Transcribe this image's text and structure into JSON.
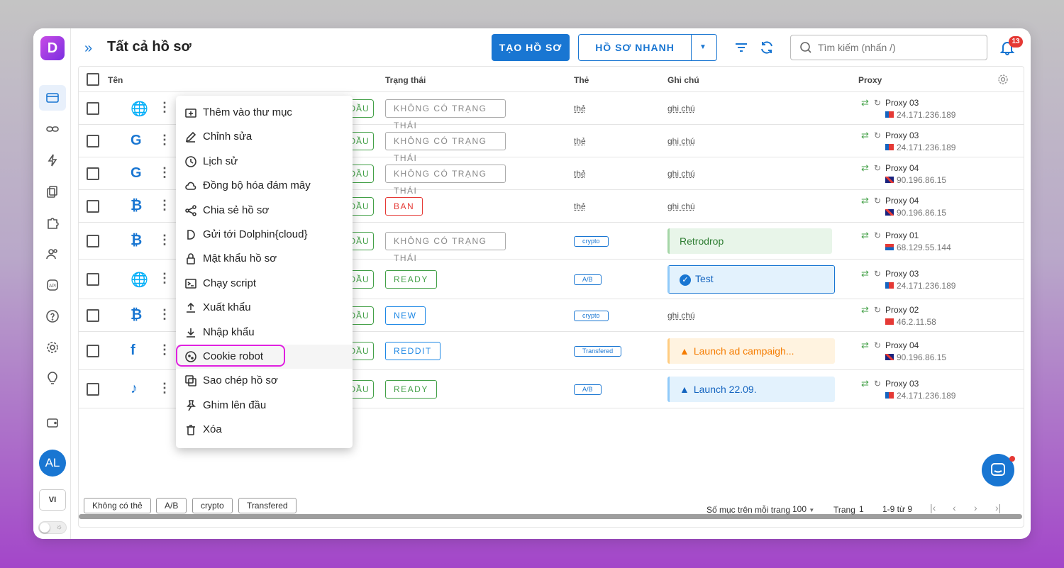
{
  "header": {
    "title": "Tất cả hồ sơ",
    "create_label": "TẠO HỒ SƠ",
    "quick_label": "HỒ SƠ NHANH",
    "search_placeholder": "Tìm kiếm (nhấn /)",
    "notification_count": "13"
  },
  "sidebar": {
    "logo": "D",
    "avatar": "AL",
    "lang": "VI"
  },
  "table": {
    "columns": [
      "Tên",
      "Trạng thái",
      "Thẻ",
      "Ghi chú",
      "Proxy"
    ],
    "start_label": "ĐẦU",
    "rows": [
      {
        "site_icon": "globe-icon",
        "status": "KHÔNG CÓ TRẠNG THÁI",
        "status_kind": "none",
        "tag": "thẻ",
        "tag_kind": "link",
        "note": "ghi chú",
        "note_kind": "link",
        "proxy": "Proxy 03",
        "ip": "24.171.236.189",
        "flag": "pr"
      },
      {
        "site_icon": "google-icon",
        "status": "KHÔNG CÓ TRẠNG THÁI",
        "status_kind": "none",
        "tag": "thẻ",
        "tag_kind": "link",
        "note": "ghi chú",
        "note_kind": "link",
        "proxy": "Proxy 03",
        "ip": "24.171.236.189",
        "flag": "pr"
      },
      {
        "site_icon": "google-icon",
        "status": "KHÔNG CÓ TRẠNG THÁI",
        "status_kind": "none",
        "tag": "thẻ",
        "tag_kind": "link",
        "note": "ghi chú",
        "note_kind": "link",
        "proxy": "Proxy 04",
        "ip": "90.196.86.15",
        "flag": "uk"
      },
      {
        "site_icon": "bitcoin-icon",
        "status": "BAN",
        "status_kind": "ban",
        "tag": "thẻ",
        "tag_kind": "link",
        "note": "ghi chú",
        "note_kind": "link",
        "proxy": "Proxy 04",
        "ip": "90.196.86.15",
        "flag": "uk"
      },
      {
        "site_icon": "bitcoin-icon",
        "status": "KHÔNG CÓ TRẠNG THÁI",
        "status_kind": "none",
        "tag": "crypto",
        "tag_kind": "chip",
        "note": "Retrodrop",
        "note_kind": "green",
        "proxy": "Proxy 01",
        "ip": "68.129.55.144",
        "flag": "us"
      },
      {
        "site_icon": "globe-icon",
        "status": "READY",
        "status_kind": "ready",
        "tag": "A/B",
        "tag_kind": "chip",
        "note": "Test",
        "note_kind": "blue",
        "proxy": "Proxy 03",
        "ip": "24.171.236.189",
        "flag": "pr"
      },
      {
        "site_icon": "bitcoin-icon",
        "status": "NEW",
        "status_kind": "new",
        "tag": "crypto",
        "tag_kind": "chip",
        "note": "ghi chú",
        "note_kind": "link",
        "proxy": "Proxy 02",
        "ip": "46.2.11.58",
        "flag": "tr"
      },
      {
        "site_icon": "facebook-icon",
        "status": "REDDIT",
        "status_kind": "reddit",
        "tag": "Transfered",
        "tag_kind": "chip",
        "note": "Launch ad campaigh...",
        "note_kind": "orange",
        "proxy": "Proxy 04",
        "ip": "90.196.86.15",
        "flag": "uk"
      },
      {
        "site_icon": "tiktok-icon",
        "status": "READY",
        "status_kind": "ready",
        "tag": "A/B",
        "tag_kind": "chip",
        "note": "Launch 22.09.",
        "note_kind": "lblue",
        "proxy": "Proxy 03",
        "ip": "24.171.236.189",
        "flag": "pr"
      }
    ]
  },
  "context_menu": {
    "items": [
      {
        "label": "Thêm vào thư mục",
        "icon": "folder-add-icon"
      },
      {
        "label": "Chỉnh sửa",
        "icon": "edit-icon"
      },
      {
        "label": "Lịch sử",
        "icon": "history-icon"
      },
      {
        "label": "Đồng bộ hóa đám mây",
        "icon": "cloud-icon"
      },
      {
        "label": "Chia sẻ hồ sơ",
        "icon": "share-icon"
      },
      {
        "label": "Gửi tới Dolphin{cloud}",
        "icon": "dolphin-icon"
      },
      {
        "label": "Mật khẩu hồ sơ",
        "icon": "lock-icon"
      },
      {
        "label": "Chạy script",
        "icon": "terminal-icon"
      },
      {
        "label": "Xuất khẩu",
        "icon": "upload-icon"
      },
      {
        "label": "Nhập khẩu",
        "icon": "download-icon"
      },
      {
        "label": "Cookie robot",
        "icon": "cookie-icon"
      },
      {
        "label": "Sao chép hồ sơ",
        "icon": "copy-icon"
      },
      {
        "label": "Ghim lên đầu",
        "icon": "pin-icon"
      },
      {
        "label": "Xóa",
        "icon": "trash-icon"
      }
    ],
    "highlighted": "Cookie robot"
  },
  "footer": {
    "tags": [
      "Không có thẻ",
      "A/B",
      "crypto",
      "Transfered"
    ],
    "per_page_label": "Số mục trên mỗi trang",
    "per_page_value": "100",
    "page_label": "Trang",
    "page_value": "1",
    "range": "1-9 từ 9"
  },
  "colors": {
    "accent": "#1976d2",
    "ready": "#43a047",
    "ban": "#e53935",
    "highlight_ring": "#e020e0"
  }
}
